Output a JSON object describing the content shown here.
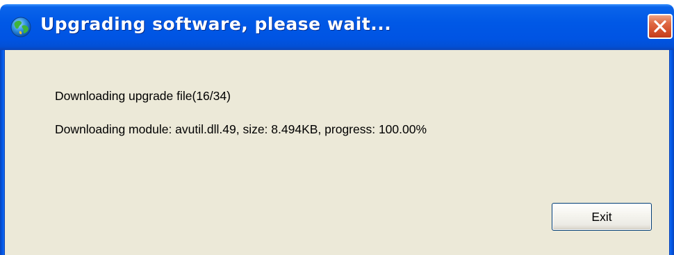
{
  "window": {
    "title": "Upgrading software, please wait...",
    "icon": "globe-icon"
  },
  "titlebar": {
    "close_icon": "close-icon"
  },
  "content": {
    "status_line": "Downloading upgrade file(16/34)",
    "module_line": "Downloading module: avutil.dll.49, size: 8.494KB, progress: 100.00%"
  },
  "buttons": {
    "exit_label": "Exit"
  },
  "colors": {
    "titlebar": "#0054e3",
    "client_background": "#ece9d8",
    "close_button": "#d4502b"
  }
}
